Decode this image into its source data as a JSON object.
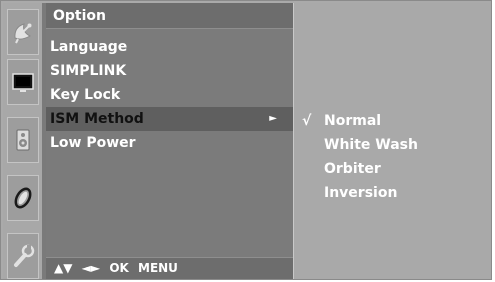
{
  "menu": {
    "title": "Option",
    "items": [
      {
        "label": "Language"
      },
      {
        "label": "SIMPLINK"
      },
      {
        "label": "Key Lock"
      },
      {
        "label": "ISM Method",
        "arrow": "►"
      },
      {
        "label": "Low Power"
      }
    ],
    "selected_index": 3
  },
  "footer": {
    "updown": "▲▼",
    "leftright": "◄►",
    "ok": "OK",
    "menu": "MENU"
  },
  "submenu": {
    "items": [
      {
        "label": "Normal",
        "check": "√"
      },
      {
        "label": "White Wash"
      },
      {
        "label": "Orbiter"
      },
      {
        "label": "Inversion"
      }
    ]
  },
  "sidebar": {
    "icons": [
      "satellite-dish-icon",
      "screen-icon",
      "speaker-icon",
      "clock-icon",
      "wrench-icon"
    ]
  }
}
